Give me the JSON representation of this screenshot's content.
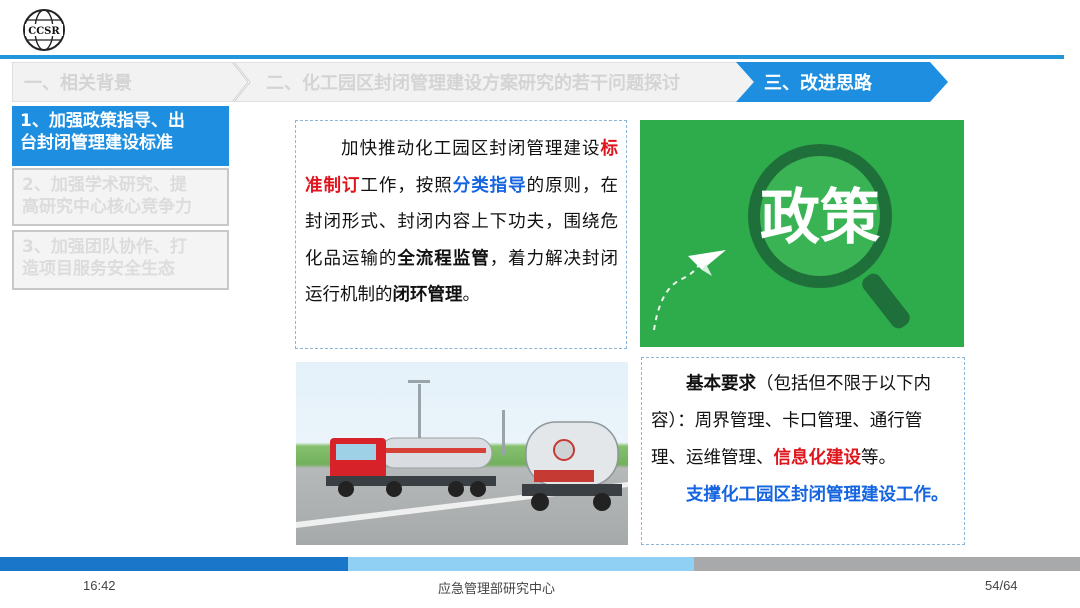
{
  "logo": {
    "text": "CCSR"
  },
  "nav": {
    "items": [
      {
        "label": "一、相关背景",
        "active": false
      },
      {
        "label": "二、化工园区封闭管理建设方案研究的若干问题探讨",
        "active": false
      },
      {
        "label": "三、改进思路",
        "active": true
      }
    ]
  },
  "sidebar": {
    "items": [
      {
        "line1": "1、加强政策指导、出",
        "line2": "台封闭管理建设标准",
        "active": true
      },
      {
        "line1": "2、加强学术研究、提",
        "line2": "高研究中心核心竞争力",
        "active": false
      },
      {
        "line1": "3、加强团队协作、打",
        "line2": "造项目服务安全生态",
        "active": false
      }
    ]
  },
  "main_text": {
    "p1": "加快推动化工园区封闭管理建设",
    "h1": "标准制订",
    "p2": "工作，按照",
    "h2": "分类指导",
    "p3": "的原则，在封闭形式、封闭内容上下功夫，围绕危化品运输的",
    "h3": "全流程监管",
    "p4": "，着力解决封闭运行机制的",
    "h4": "闭环管理",
    "p5": "。"
  },
  "policy_image": {
    "text": "政策"
  },
  "requirements": {
    "title": "基本要求",
    "t1": "（包括但不限于以下内容）：周界管理、卡口管理、通行管理、运维管理、",
    "highlight": "信息化建设",
    "t2": "等。",
    "support": "支撑化工园区封闭管理建设工作。"
  },
  "footer": {
    "time": "16:42",
    "org": "应急管理部研究中心",
    "page": "54/64"
  },
  "colors": {
    "accent": "#1e8fe0",
    "highlight_red": "#e0141c",
    "highlight_blue": "#1565e0",
    "policy_green": "#2eac4c"
  }
}
